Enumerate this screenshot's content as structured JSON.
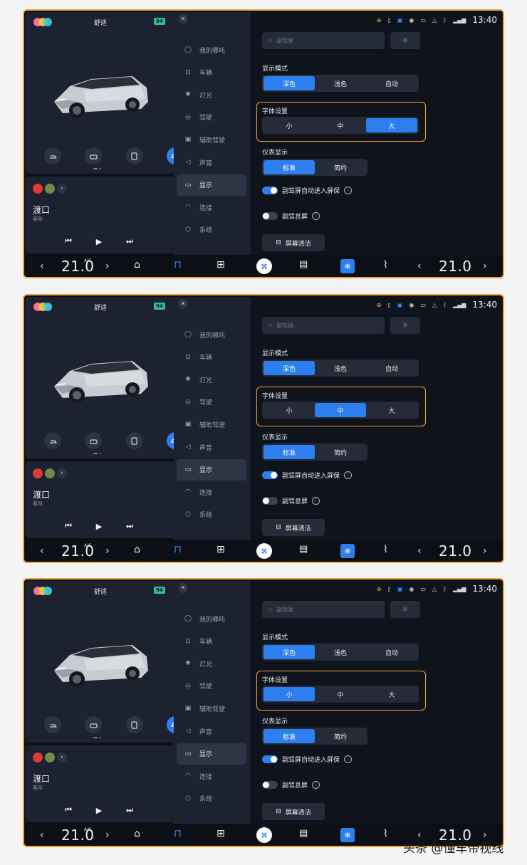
{
  "header": {
    "mode_label": "舒适",
    "battery": "94"
  },
  "quick_icons": [
    "trunk-icon",
    "car-lock-icon",
    "charge-door-icon",
    "car-front-icon"
  ],
  "media": {
    "song": "渡口",
    "artist": "蔡琴",
    "controls": {
      "prev": "⏮",
      "play": "▶",
      "next": "⏭"
    }
  },
  "nav": {
    "items": [
      {
        "label": "我的哪吒",
        "icon": "user-icon"
      },
      {
        "label": "车辆",
        "icon": "car-icon"
      },
      {
        "label": "灯光",
        "icon": "light-icon"
      },
      {
        "label": "驾驶",
        "icon": "steering-wheel-icon"
      },
      {
        "label": "辅助驾驶",
        "icon": "assist-drive-icon"
      },
      {
        "label": "声音",
        "icon": "speaker-icon"
      },
      {
        "label": "显示",
        "icon": "display-icon"
      },
      {
        "label": "连接",
        "icon": "wifi-icon"
      },
      {
        "label": "系统",
        "icon": "system-icon"
      }
    ],
    "active_index": 6
  },
  "status": {
    "time": "13:40"
  },
  "settings": {
    "copilot_screen_placeholder": "副驾屏",
    "display_mode": {
      "label": "显示模式",
      "options": [
        "深色",
        "浅色",
        "自动"
      ],
      "selected": 0
    },
    "font": {
      "label": "字体设置",
      "options": [
        "小",
        "中",
        "大"
      ]
    },
    "instrument": {
      "label": "仪表显示",
      "options": [
        "标准",
        "简约"
      ],
      "selected": 0
    },
    "toggle_auto_screensaver": {
      "label": "副驾屏自动进入屏保",
      "on": true
    },
    "toggle_screen_off": {
      "label": "副驾息屏",
      "on": false
    },
    "clean_button": "屏幕清洁"
  },
  "dock": {
    "left_temp": "21.0",
    "ac_label": "A/C",
    "right_temp": "21.0"
  },
  "screens": [
    {
      "font_selected": 2
    },
    {
      "font_selected": 1
    },
    {
      "font_selected": 0
    }
  ],
  "watermark": "头条 @懂车帝视线",
  "colors": {
    "accent": "#2d7ff0",
    "highlight": "#f0a23b",
    "bg": "#0c0f15",
    "panel": "#1d2230"
  }
}
